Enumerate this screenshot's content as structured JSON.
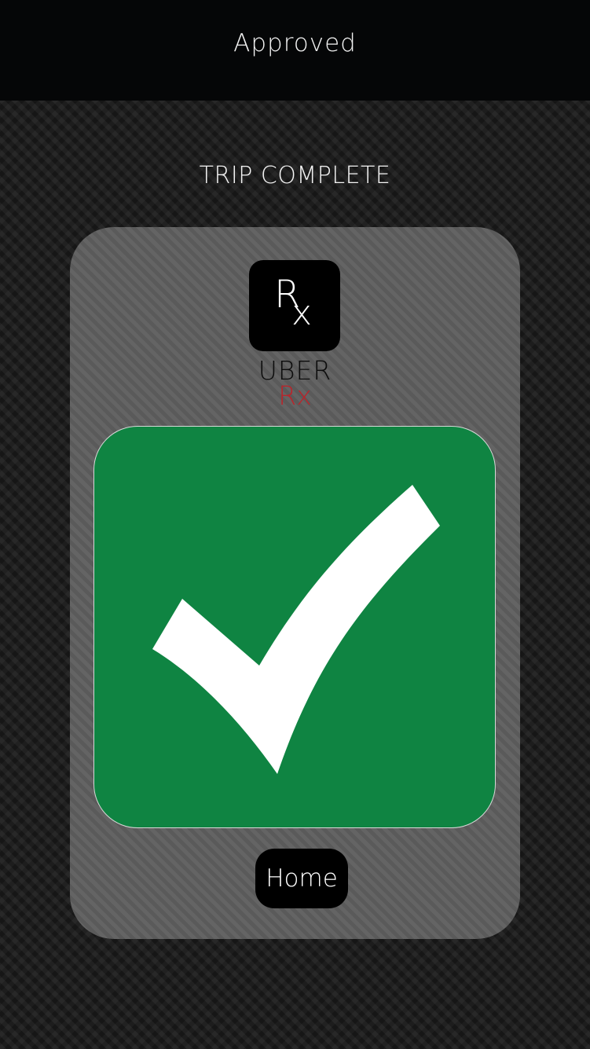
{
  "header": {
    "title": "Approved"
  },
  "status": {
    "heading": "TRIP COMPLETE"
  },
  "brand": {
    "logo_icon": "rx-logo-icon",
    "logo_letter_main": "R",
    "logo_letter_sub": "x",
    "name": "UBER",
    "sub": "Rx"
  },
  "result": {
    "icon": "checkmark-icon",
    "color": "#0f8442"
  },
  "actions": {
    "home_label": "Home"
  }
}
